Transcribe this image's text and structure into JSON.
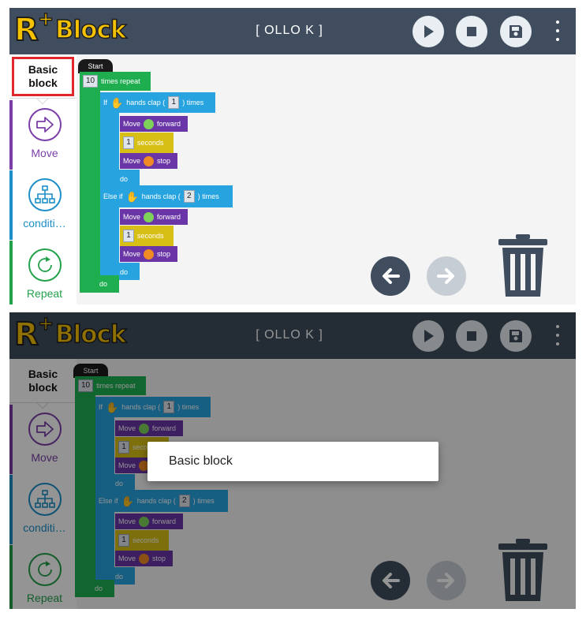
{
  "app": {
    "logo_text": "R+Block",
    "robot_name": "[ OLLO K ]",
    "buttons": {
      "play": "play-icon",
      "stop": "stop-icon",
      "save": "save-icon",
      "more": "more-vert-icon"
    }
  },
  "sidebar": {
    "basic_label": "Basic block",
    "items": [
      {
        "label": "Move",
        "icon": "arrow-right-icon",
        "color": "#7b3ea8"
      },
      {
        "label": "conditi…",
        "icon": "hierarchy-icon",
        "color": "#1e8fc8"
      },
      {
        "label": "Repeat",
        "icon": "repeat-icon",
        "color": "#23a14b"
      }
    ]
  },
  "program": {
    "start": "Start",
    "repeat": {
      "count": "10",
      "label": "times repeat",
      "do": "do"
    },
    "if_block": {
      "if_label": "If",
      "condition": "hands clap (",
      "count": "1",
      "times": ") times",
      "body": [
        {
          "action": "Move",
          "arg": "forward"
        },
        {
          "seconds_value": "1",
          "seconds_label": "seconds"
        },
        {
          "action": "Move",
          "arg": "stop"
        }
      ],
      "do": "do"
    },
    "else_if_block": {
      "label": "Else if",
      "condition": "hands clap (",
      "count": "2",
      "times": ") times",
      "body": [
        {
          "action": "Move",
          "arg": "forward"
        },
        {
          "seconds_value": "1",
          "seconds_label": "seconds"
        },
        {
          "action": "Move",
          "arg": "stop"
        }
      ],
      "do": "do"
    }
  },
  "dialog": {
    "text": "Basic block"
  },
  "colors": {
    "topbar": "#3f4d5e",
    "repeat_block": "#1eae50",
    "condition_block": "#27a4e0",
    "move_block": "#6a36a7",
    "time_block": "#d7bf16",
    "highlight": "#e0282c"
  }
}
